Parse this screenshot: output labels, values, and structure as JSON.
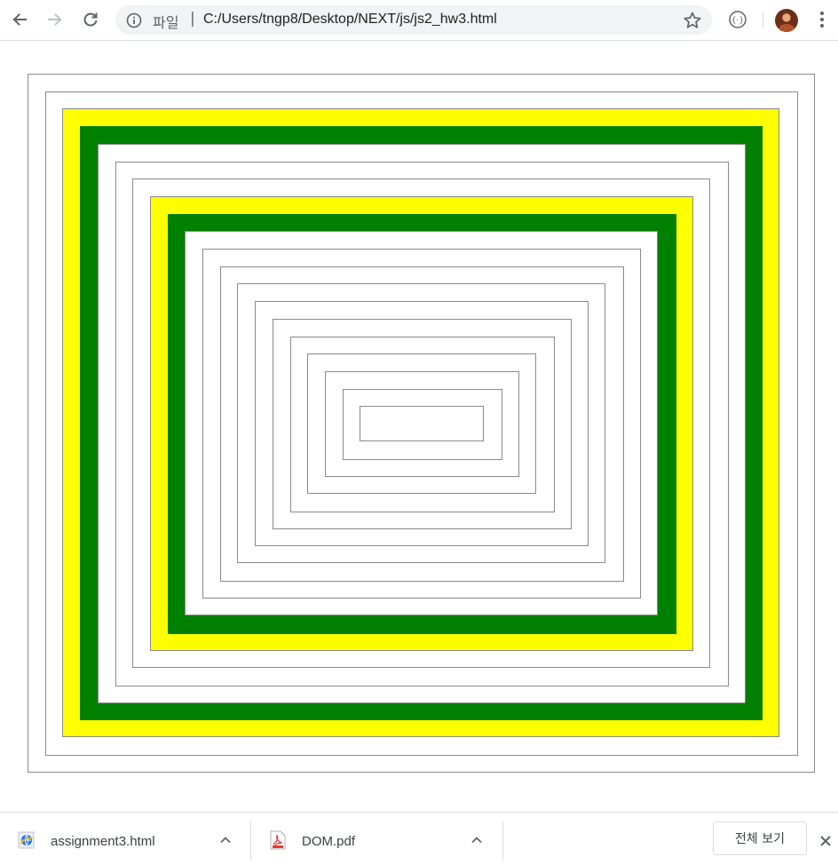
{
  "browser": {
    "nav": {
      "back_icon": "arrow-left-icon",
      "forward_icon": "arrow-right-icon",
      "reload_icon": "reload-icon"
    },
    "omnibox": {
      "info_icon": "info-icon",
      "scheme_label": "파일",
      "separator": "|",
      "url": "C:/Users/tngp8/Desktop/NEXT/js/js2_hw3.html",
      "bookmark_icon": "star-icon"
    },
    "extension_icon": "extension-icon",
    "profile_avatar": "avatar",
    "menu_icon": "kebab-menu-icon"
  },
  "page": {
    "description_colors": {
      "border": "#8a8a8a",
      "yellow": "#ffff00",
      "green": "#008000"
    },
    "rectangles": [
      {
        "fill": "white"
      },
      {
        "fill": "white"
      },
      {
        "fill": "yellow"
      },
      {
        "fill": "green"
      },
      {
        "fill": "white"
      },
      {
        "fill": "white"
      },
      {
        "fill": "white"
      },
      {
        "fill": "yellow"
      },
      {
        "fill": "green"
      },
      {
        "fill": "white"
      },
      {
        "fill": "white"
      },
      {
        "fill": "white"
      },
      {
        "fill": "white"
      },
      {
        "fill": "white"
      },
      {
        "fill": "white"
      },
      {
        "fill": "white"
      },
      {
        "fill": "white"
      },
      {
        "fill": "white"
      },
      {
        "fill": "white"
      },
      {
        "fill": "white"
      }
    ]
  },
  "download_shelf": {
    "items": [
      {
        "name": "assignment3.html",
        "icon": "html-file-icon"
      },
      {
        "name": "DOM.pdf",
        "icon": "pdf-file-icon"
      }
    ],
    "show_all_label": "전체 보기",
    "close_icon": "close-icon"
  }
}
